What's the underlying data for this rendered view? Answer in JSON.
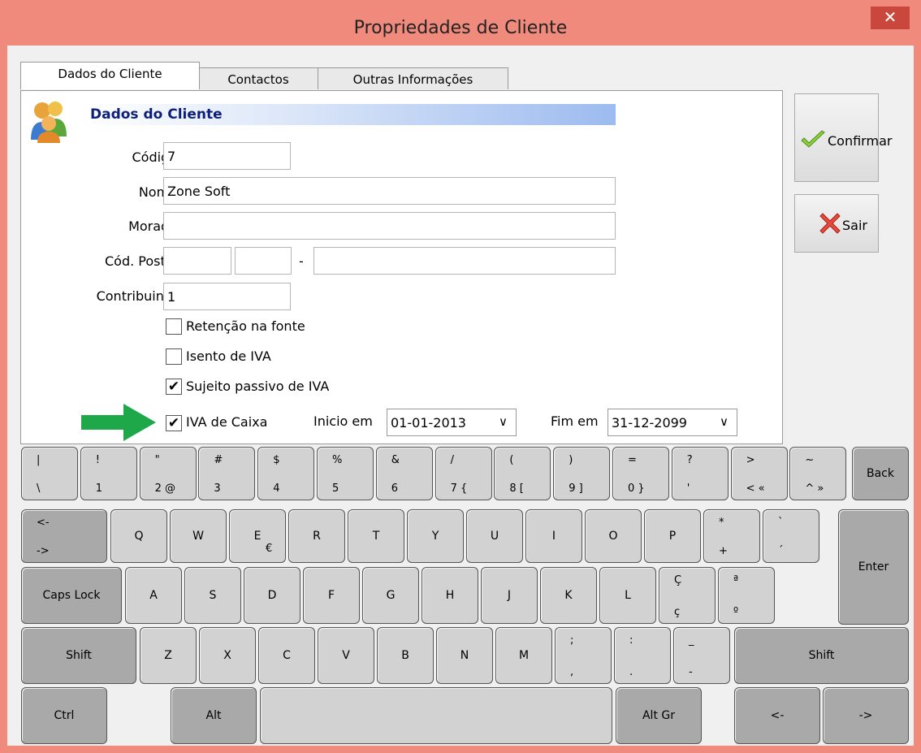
{
  "window": {
    "title": "Propriedades de Cliente",
    "close_label": "✕"
  },
  "tabs": [
    {
      "label": "Dados do Cliente"
    },
    {
      "label": "Contactos"
    },
    {
      "label": "Outras Informações"
    }
  ],
  "section": {
    "title": "Dados do Cliente"
  },
  "form": {
    "codigo_label": "Código",
    "codigo_value": "7",
    "nome_label": "Nome",
    "nome_value": "Zone Soft",
    "morada_label": "Morada",
    "morada_value": "",
    "cod_postal_label": "Cód. Postal",
    "cod_postal_sep": "-",
    "contribuinte_label": "Contribuinte",
    "contribuinte_value": "1",
    "retencao_label": "Retenção na fonte",
    "retencao_checked": false,
    "isento_label": "Isento de IVA",
    "isento_checked": false,
    "sujeito_label": "Sujeito passivo de IVA",
    "sujeito_checked": true,
    "iva_caixa_label": "IVA de Caixa",
    "iva_caixa_checked": true,
    "inicio_label": "Inicio em",
    "inicio_value": "01-01-2013",
    "fim_label": "Fim em",
    "fim_value": "31-12-2099",
    "check_mark": "✔",
    "dropdown_arrow": "∨"
  },
  "buttons": {
    "confirm_label": "Confirmar",
    "exit_label": "Sair",
    "confirm_icon": "checkmark-icon",
    "exit_icon": "cross-icon"
  },
  "keyboard": {
    "row1": [
      {
        "t": "|",
        "b": "\\"
      },
      {
        "t": "!",
        "b": "1"
      },
      {
        "t": "\"",
        "b": "2  @"
      },
      {
        "t": "#",
        "b": "3"
      },
      {
        "t": "$",
        "b": "4"
      },
      {
        "t": "%",
        "b": "5"
      },
      {
        "t": "&",
        "b": "6"
      },
      {
        "t": "/",
        "b": "7  {"
      },
      {
        "t": "(",
        "b": "8  ["
      },
      {
        "t": ")",
        "b": "9  ]"
      },
      {
        "t": "=",
        "b": "0  }"
      },
      {
        "t": "?",
        "b": "'"
      },
      {
        "t": ">",
        "b": "<  «"
      },
      {
        "t": "~",
        "b": "^  »"
      }
    ],
    "back": "Back",
    "tab_top": "<-",
    "tab_bottom": "->",
    "row2": [
      "Q",
      "W",
      "E",
      "R",
      "T",
      "Y",
      "U",
      "I",
      "O",
      "P"
    ],
    "e_alt": "€",
    "row2_extra": [
      {
        "t": "*",
        "b": "+"
      },
      {
        "t": "`",
        "b": "´"
      }
    ],
    "enter": "Enter",
    "caps": "Caps Lock",
    "row3": [
      "A",
      "S",
      "D",
      "F",
      "G",
      "H",
      "J",
      "K",
      "L"
    ],
    "row3_extra": [
      {
        "t": "Ç",
        "b": "ç"
      },
      {
        "t": "ª",
        "b": "º"
      }
    ],
    "shift": "Shift",
    "row4": [
      "Z",
      "X",
      "C",
      "V",
      "B",
      "N",
      "M"
    ],
    "row4_extra": [
      {
        "t": ";",
        "b": ","
      },
      {
        "t": ":",
        "b": "."
      },
      {
        "t": "_",
        "b": "-"
      }
    ],
    "ctrl": "Ctrl",
    "alt": "Alt",
    "altgr": "Alt Gr",
    "left": "<-",
    "right": "->"
  },
  "colors": {
    "titlebar": "#f08a7c",
    "close": "#c9473c",
    "header_text": "#0c1f7a",
    "key": "#d2d2d2",
    "key_dark": "#a9a9a9",
    "arrow": "#1fa84a"
  }
}
